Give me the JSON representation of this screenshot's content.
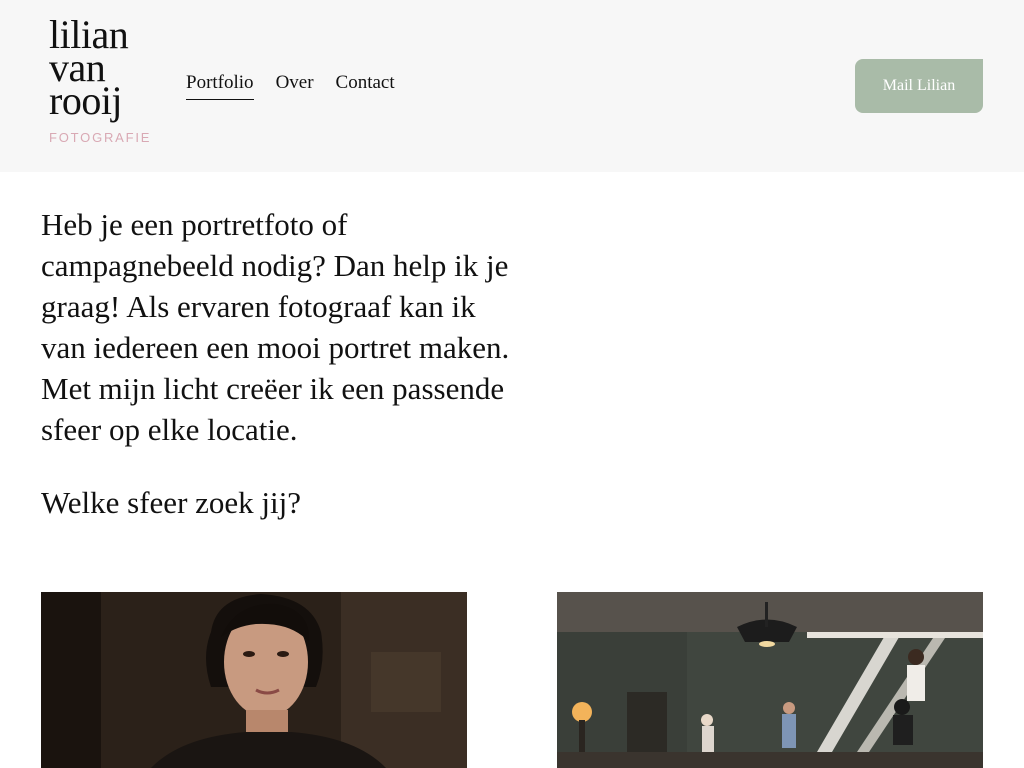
{
  "brand": {
    "line1": "lilian",
    "line2": "van",
    "line3": "rooij",
    "subtitle": "FOTOGRAFIE"
  },
  "nav": {
    "items": [
      {
        "label": "Portfolio",
        "active": true
      },
      {
        "label": "Over",
        "active": false
      },
      {
        "label": "Contact",
        "active": false
      }
    ]
  },
  "cta": {
    "label": "Mail Lilian"
  },
  "intro": {
    "text": "Heb je een portretfoto of campagnebeeld nodig? Dan help ik je graag! Als ervaren fotograaf kan ik van iedereen een mooi portret maken. Met mijn licht creëer ik een passende sfeer op elke locatie.",
    "question": "Welke sfeer zoek jij?"
  },
  "colors": {
    "header_bg": "#f7f7f7",
    "accent_green": "#a9bba8",
    "brand_pink": "#d9a9b4"
  }
}
